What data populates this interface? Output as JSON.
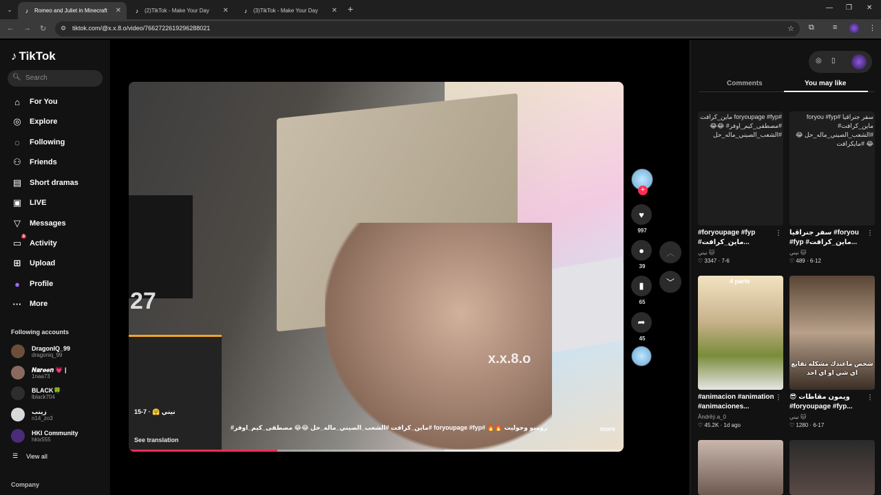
{
  "browser": {
    "tabs": [
      {
        "title": "Romeo and Juliet in Minecraft",
        "active": true
      },
      {
        "title": "(2)TikTok - Make Your Day",
        "active": false
      },
      {
        "title": "(3)TikTok - Make Your Day",
        "active": false
      }
    ],
    "url": "tiktok.com/@x.x.8.o/video/7662722619296288021"
  },
  "sidebar": {
    "logo": "TikTok",
    "search_placeholder": "Search",
    "menu": [
      {
        "label": "For You",
        "icon": "home-icon"
      },
      {
        "label": "Explore",
        "icon": "compass-icon"
      },
      {
        "label": "Following",
        "icon": "following-icon"
      },
      {
        "label": "Friends",
        "icon": "friends-icon"
      },
      {
        "label": "Short dramas",
        "icon": "drama-icon"
      },
      {
        "label": "LIVE",
        "icon": "live-icon"
      },
      {
        "label": "Messages",
        "icon": "messages-icon"
      },
      {
        "label": "Activity",
        "icon": "activity-icon",
        "badge": "3"
      },
      {
        "label": "Upload",
        "icon": "upload-icon"
      },
      {
        "label": "Profile",
        "icon": "profile-icon"
      },
      {
        "label": "More",
        "icon": "more-icon"
      }
    ],
    "following_title": "Following accounts",
    "accounts": [
      {
        "name": "DragonIQ_99",
        "handle": "dragoniq_99"
      },
      {
        "name": "𝑵𝒂𝒓𝒆𝒆𝒏 💗 |",
        "handle": "1naa73"
      },
      {
        "name": "BLACK🍀",
        "handle": "lblack704"
      },
      {
        "name": "زينب",
        "handle": "n14_zo3"
      },
      {
        "name": "HKI Community",
        "handle": "hkix555"
      }
    ],
    "view_all": "View all",
    "company": "Company"
  },
  "video": {
    "watermark": "x.x.8.o",
    "author_meta": "نيني 🤗 · 7-15",
    "caption": "رومبو وجوليت 🔥🔥 #foryoupage #fyp #ماين_كرافت #الشعب_الصيني_ماله_حل 😂😂 مصطفى_كيم_اوفر#",
    "see_translation": "See translation",
    "more": "more",
    "progress": 0.3
  },
  "actions": {
    "likes": "997",
    "comments": "39",
    "saves": "65",
    "shares": "45"
  },
  "rightpanel": {
    "tab_comments": "Comments",
    "tab_you_may_like": "You may like",
    "cards": [
      {
        "alt": "#foryoupage #fyp ماين_كرافت #مصطفى_كيم_اوفر# 😂😂 #الشعب_الصيني_ماله_حل",
        "title": "#foryoupage #fyp #ماين_كرافت...",
        "user": "نيني 🐱",
        "likes": "3347",
        "date": "7-6"
      },
      {
        "alt": "سفر جنراقيا #foryou #fyp ماين_كرافت# #الشعب_الصيني_ماله_حل 😂😂 #مايكرافت",
        "title": "سفر جنراقيا #foryou #fyp #ماين_كرافت...",
        "user": "نيني 🐱",
        "likes": "489",
        "date": "6-12"
      },
      {
        "alt": "4 parte",
        "title": "#animacion #animation #animaciones...",
        "user": "Ăndrěý.a_0",
        "likes": "45.2K",
        "date": "1d ago"
      },
      {
        "alt": "شخص ماعندك مشكله تقايع اي شي او اي احد",
        "title": "😎 ويمون مقاطات #foryoupage #fyp...",
        "user": "نيني 🐱",
        "likes": "1280",
        "date": "6-17"
      }
    ]
  }
}
